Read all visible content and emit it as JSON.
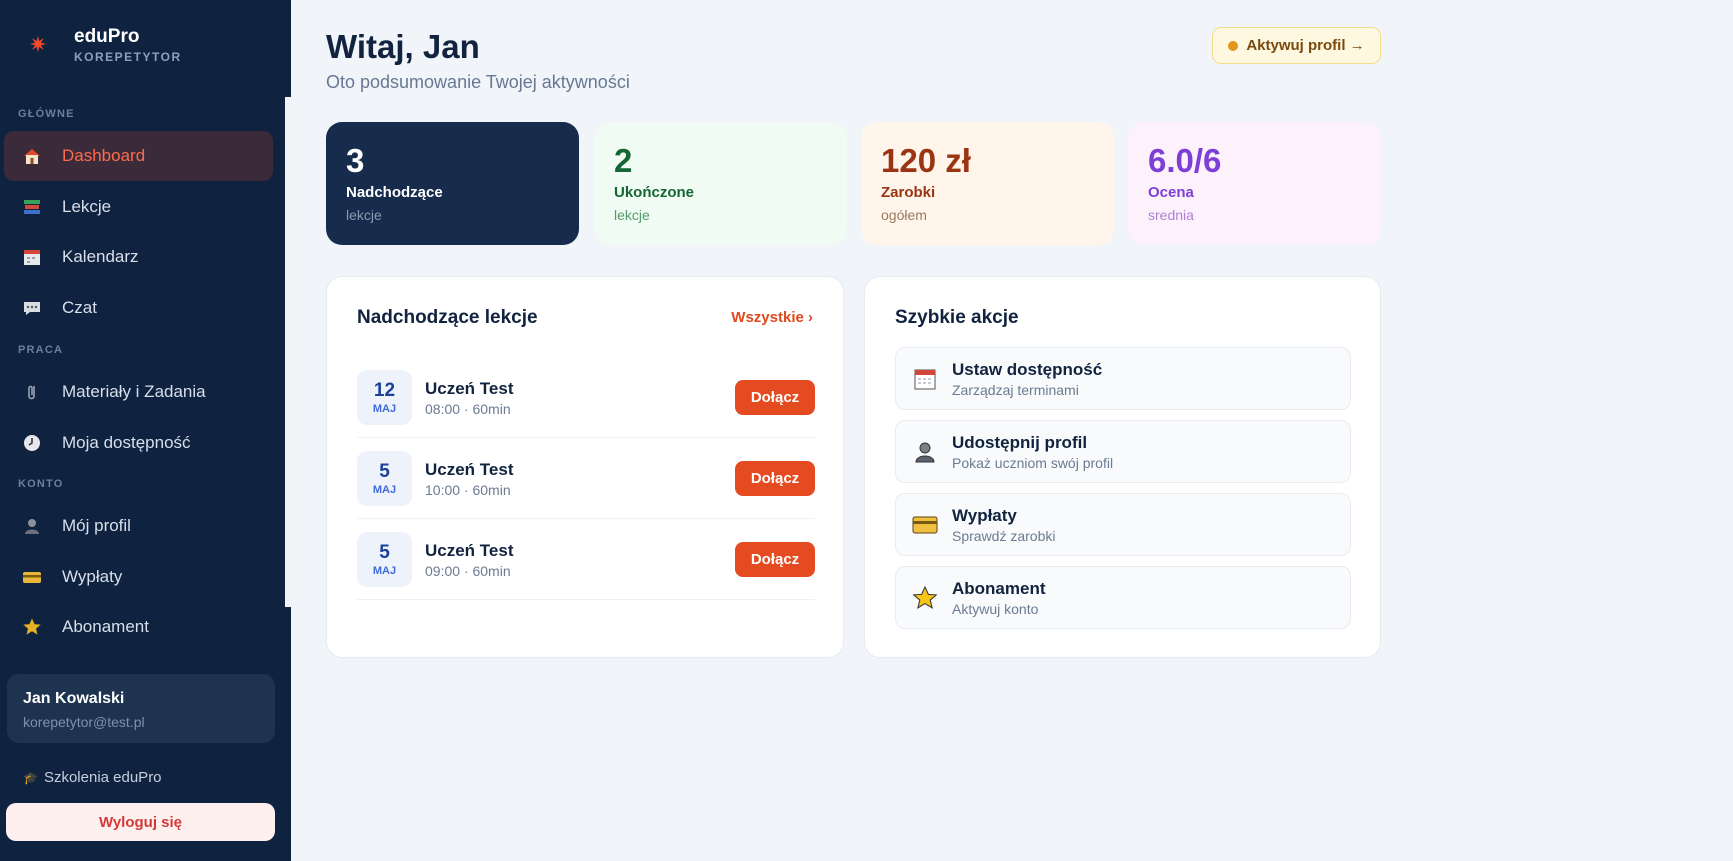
{
  "brand": {
    "name": "eduPro",
    "subtitle": "KOREPETYTOR"
  },
  "sidebar": {
    "sections": {
      "main": "GŁÓWNE",
      "work": "PRACA",
      "account": "KONTO"
    },
    "items": {
      "dashboard": "Dashboard",
      "lessons": "Lekcje",
      "calendar": "Kalendarz",
      "chat": "Czat",
      "materials": "Materiały i Zadania",
      "availability": "Moja dostępność",
      "profile": "Mój profil",
      "payouts": "Wypłaty",
      "subscription": "Abonament"
    },
    "user": {
      "name": "Jan Kowalski",
      "email": "korepetytor@test.pl"
    },
    "training": "Szkolenia eduPro",
    "logout": "Wyloguj się"
  },
  "header": {
    "title": "Witaj, Jan",
    "subtitle": "Oto podsumowanie Twojej aktywności",
    "activate": "Aktywuj profil →"
  },
  "stats": [
    {
      "value": "3",
      "label": "Nadchodzące",
      "sub": "lekcje"
    },
    {
      "value": "2",
      "label": "Ukończone",
      "sub": "lekcje"
    },
    {
      "value": "120 zł",
      "label": "Zarobki",
      "sub": "ogółem"
    },
    {
      "value": "6.0/6",
      "label": "Ocena",
      "sub": "srednia"
    }
  ],
  "upcoming": {
    "title": "Nadchodzące lekcje",
    "see_all": "Wszystkie ›",
    "lessons": [
      {
        "day": "12",
        "month": "MAJ",
        "student": "Uczeń Test",
        "time": "08:00 · 60min",
        "join": "Dołącz"
      },
      {
        "day": "5",
        "month": "MAJ",
        "student": "Uczeń Test",
        "time": "10:00 · 60min",
        "join": "Dołącz"
      },
      {
        "day": "5",
        "month": "MAJ",
        "student": "Uczeń Test",
        "time": "09:00 · 60min",
        "join": "Dołącz"
      }
    ]
  },
  "quick_actions": {
    "title": "Szybkie akcje",
    "items": [
      {
        "title": "Ustaw dostępność",
        "sub": "Zarządzaj terminami",
        "icon": "calendar-icon"
      },
      {
        "title": "Udostępnij profil",
        "sub": "Pokaż uczniom swój profil",
        "icon": "person-icon"
      },
      {
        "title": "Wypłaty",
        "sub": "Sprawdź zarobki",
        "icon": "card-icon"
      },
      {
        "title": "Abonament",
        "sub": "Aktywuj konto",
        "icon": "star-icon"
      }
    ]
  },
  "colors": {
    "accent": "#e54b21",
    "sidebar": "#0f2340",
    "background": "#f1f4f9"
  }
}
